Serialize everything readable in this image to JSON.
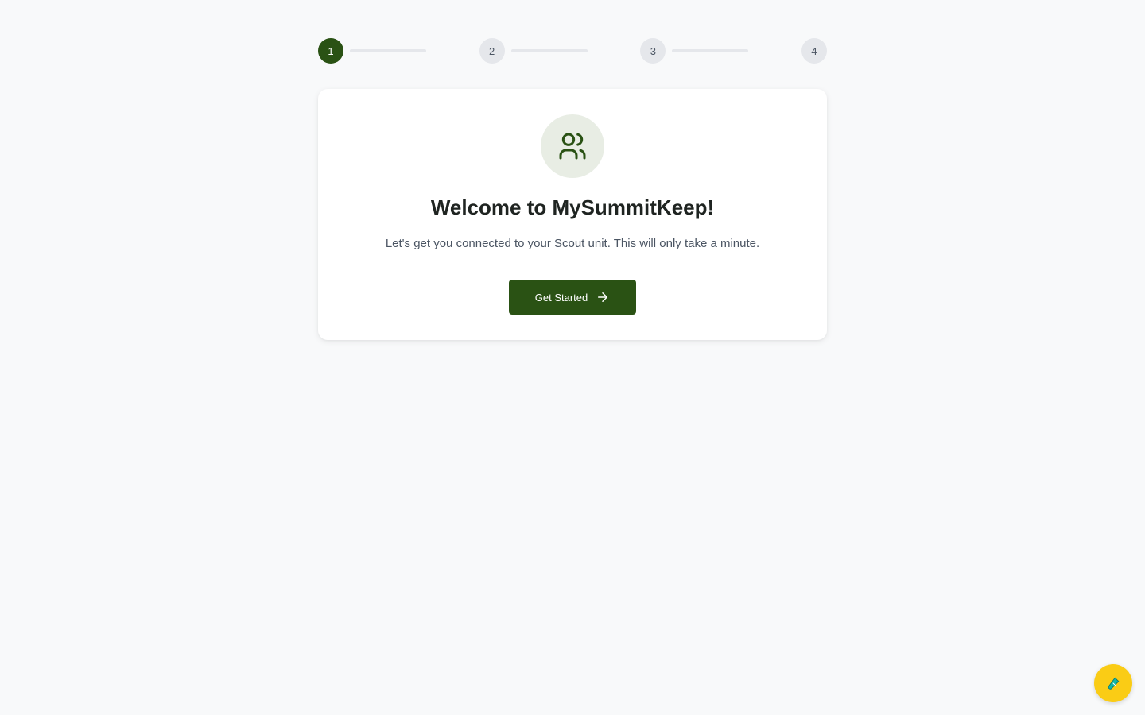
{
  "stepper": {
    "current_step": 1,
    "steps": [
      {
        "label": "1",
        "state": "active"
      },
      {
        "label": "2",
        "state": "inactive"
      },
      {
        "label": "3",
        "state": "inactive"
      },
      {
        "label": "4",
        "state": "inactive"
      }
    ]
  },
  "welcome": {
    "icon": "users-icon",
    "title": "Welcome to MySummitKeep!",
    "subtitle": "Let's get you connected to your Scout unit. This will only take a minute.",
    "cta_label": "Get Started",
    "cta_icon": "arrow-right-icon"
  },
  "fab": {
    "icon": "test-tube-icon"
  },
  "colors": {
    "primary": "#2a5214",
    "icon_bg": "#e8ede4",
    "inactive_step": "#e5e7eb",
    "fab": "#facc15",
    "background": "#f8f9fa"
  }
}
